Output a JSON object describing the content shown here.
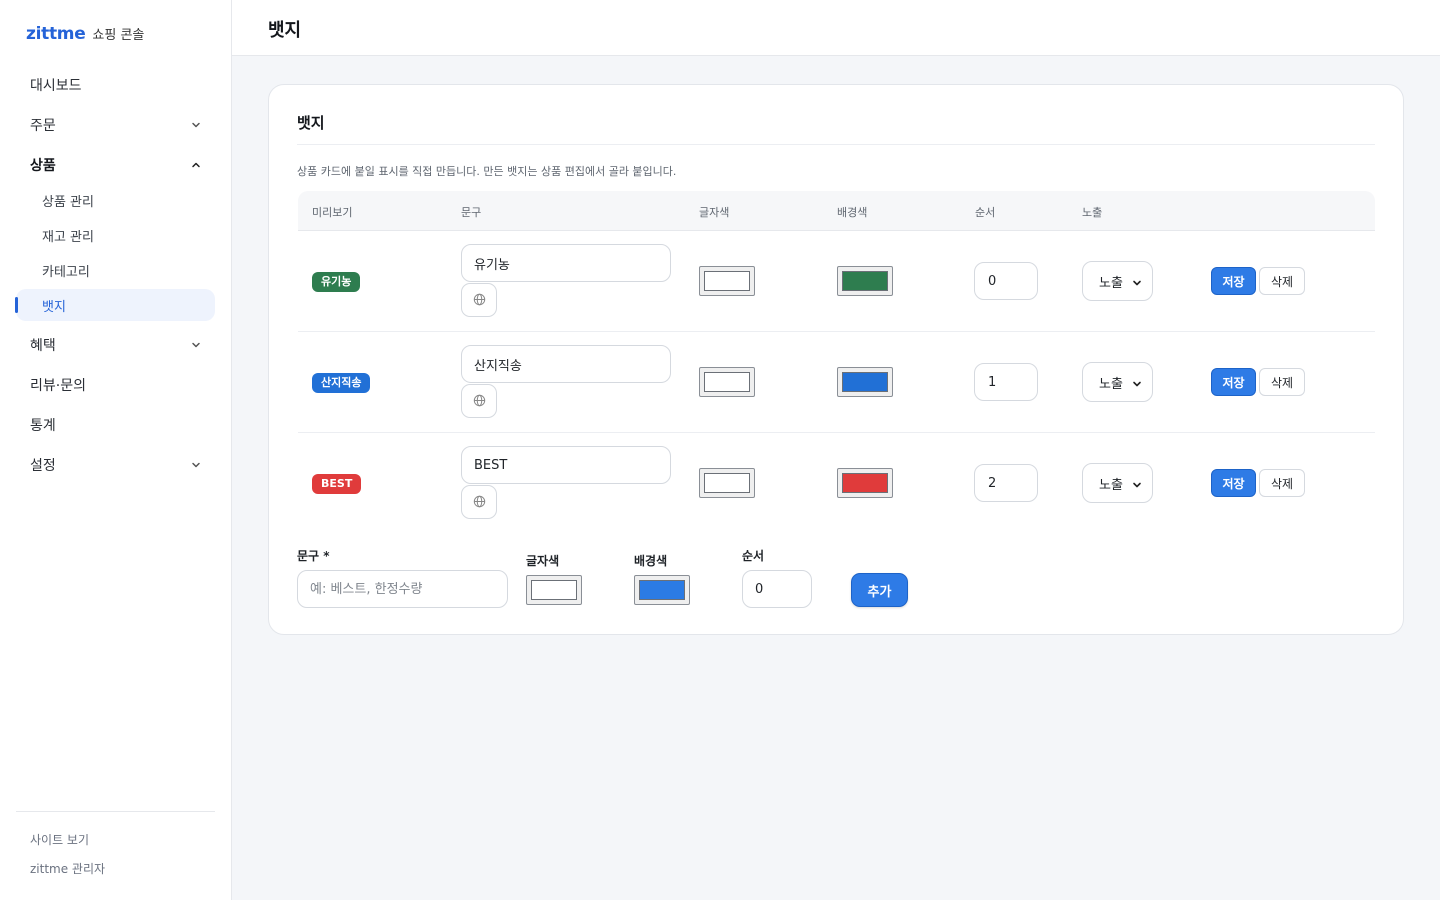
{
  "brand": {
    "logo": "zittme",
    "subtitle": "쇼핑 콘솔"
  },
  "nav": {
    "dashboard": "대시보드",
    "orders": "주문",
    "products": "상품",
    "products_sub": [
      "상품 관리",
      "재고 관리",
      "카테고리",
      "뱃지"
    ],
    "benefits": "혜택",
    "reviews": "리뷰·문의",
    "stats": "통계",
    "settings": "설정"
  },
  "footer": {
    "site_link": "사이트 보기",
    "admin_user": "zittme 관리자"
  },
  "page": {
    "title": "뱃지"
  },
  "card": {
    "title": "뱃지",
    "description": "상품 카드에 붙일 표시를 직접 만듭니다. 만든 뱃지는 상품 편집에서 골라 붙입니다."
  },
  "table": {
    "headers": {
      "preview": "미리보기",
      "text": "문구",
      "text_color": "글자색",
      "bg_color": "배경색",
      "order": "순서",
      "visibility": "노출"
    },
    "rows": [
      {
        "preview": "유기농",
        "text": "유기농",
        "text_color": "#ffffff",
        "bg_color": "#2e7d4f",
        "order": "0",
        "visibility": "노출",
        "save": "저장",
        "delete": "삭제"
      },
      {
        "preview": "산지직송",
        "text": "산지직송",
        "text_color": "#ffffff",
        "bg_color": "#2170d6",
        "order": "1",
        "visibility": "노출",
        "save": "저장",
        "delete": "삭제"
      },
      {
        "preview": "BEST",
        "text": "BEST",
        "text_color": "#ffffff",
        "bg_color": "#e03b3b",
        "order": "2",
        "visibility": "노출",
        "save": "저장",
        "delete": "삭제"
      }
    ]
  },
  "add_form": {
    "text_label": "문구 *",
    "text_placeholder": "예: 베스트, 한정수량",
    "text_color_label": "글자색",
    "text_color": "#ffffff",
    "bg_color_label": "배경색",
    "bg_color": "#2b7be4",
    "order_label": "순서",
    "order_value": "0",
    "add_button": "추가"
  }
}
